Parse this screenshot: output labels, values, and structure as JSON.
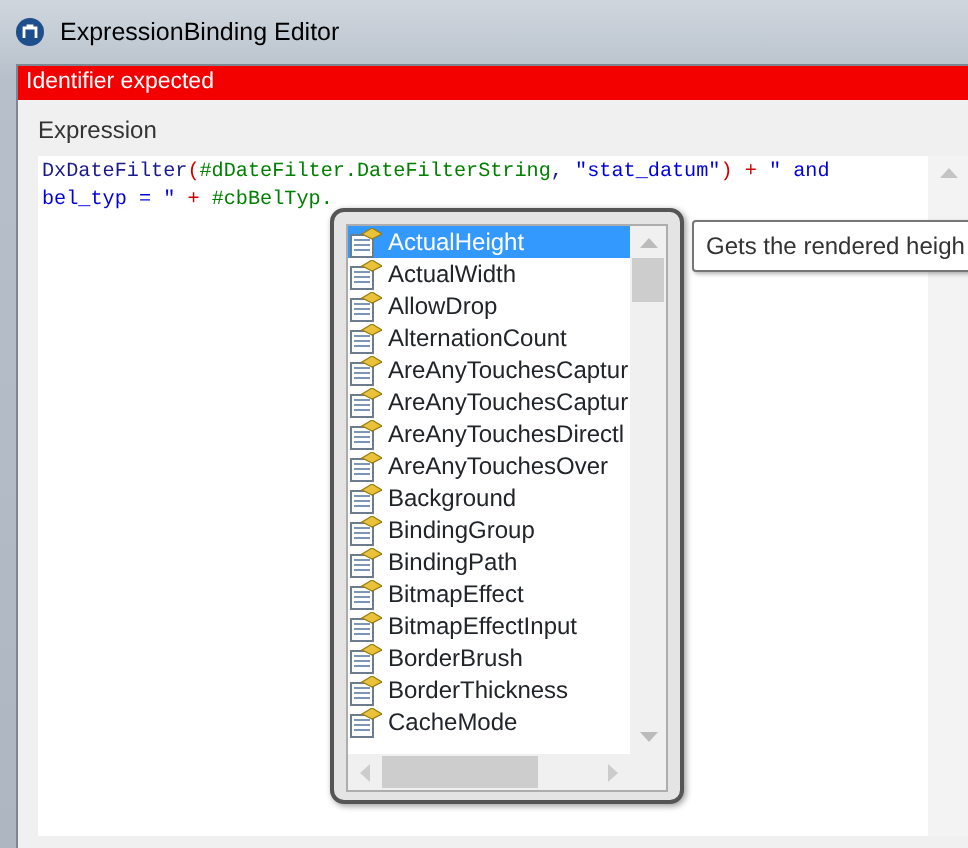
{
  "window": {
    "title": "ExpressionBinding Editor"
  },
  "error": "Identifier expected",
  "section": {
    "label": "Expression"
  },
  "editor": {
    "lines": [
      [
        {
          "kind": "ident",
          "text": "DxDateFilter"
        },
        {
          "kind": "op",
          "text": "("
        },
        {
          "kind": "ref",
          "text": "#dDateFilter.DateFilterString"
        },
        {
          "kind": "ident",
          "text": ", "
        },
        {
          "kind": "string",
          "text": "\"stat_datum\""
        },
        {
          "kind": "op",
          "text": ") + "
        },
        {
          "kind": "string",
          "text": "\" and"
        }
      ],
      [
        {
          "kind": "string",
          "text": "bel_typ = \""
        },
        {
          "kind": "op",
          "text": " + "
        },
        {
          "kind": "ref",
          "text": "#cbBelTyp."
        }
      ]
    ]
  },
  "completion": {
    "items": [
      {
        "label": "ActualHeight",
        "selected": true
      },
      {
        "label": "ActualWidth",
        "selected": false
      },
      {
        "label": "AllowDrop",
        "selected": false
      },
      {
        "label": "AlternationCount",
        "selected": false
      },
      {
        "label": "AreAnyTouchesCaptur",
        "selected": false
      },
      {
        "label": "AreAnyTouchesCaptur",
        "selected": false
      },
      {
        "label": "AreAnyTouchesDirectl",
        "selected": false
      },
      {
        "label": "AreAnyTouchesOver",
        "selected": false
      },
      {
        "label": "Background",
        "selected": false
      },
      {
        "label": "BindingGroup",
        "selected": false
      },
      {
        "label": "BindingPath",
        "selected": false
      },
      {
        "label": "BitmapEffect",
        "selected": false
      },
      {
        "label": "BitmapEffectInput",
        "selected": false
      },
      {
        "label": "BorderBrush",
        "selected": false
      },
      {
        "label": "BorderThickness",
        "selected": false
      },
      {
        "label": "CacheMode",
        "selected": false
      }
    ],
    "tooltip": "Gets the rendered heigh"
  }
}
